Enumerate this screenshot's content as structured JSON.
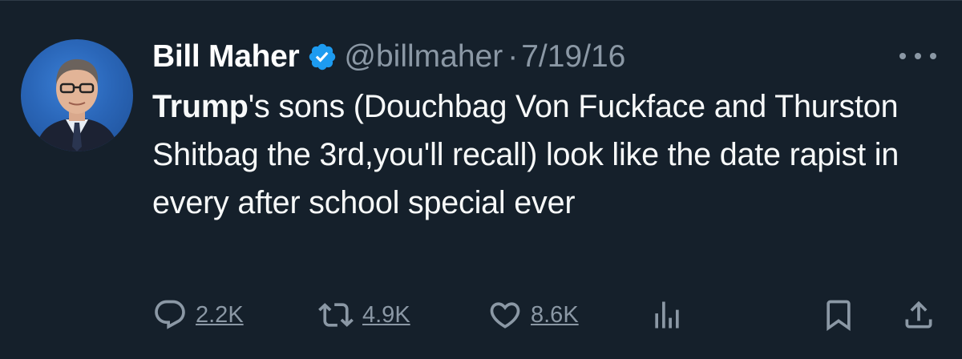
{
  "tweet": {
    "author": {
      "name": "Bill Maher",
      "handle": "@billmaher",
      "verified": true
    },
    "separator": "·",
    "date": "7/19/16",
    "text_bold": "Trump",
    "text_rest": "'s sons (Douchbag Von Fuckface and Thurston Shitbag the 3rd,you'll recall) look like the date rapist in every after school special ever",
    "stats": {
      "replies": "2.2K",
      "retweets": "4.9K",
      "likes": "8.6K"
    }
  },
  "icons": {
    "verified": "verified-badge-icon",
    "more": "more-options-icon",
    "reply": "reply-icon",
    "retweet": "retweet-icon",
    "like": "heart-icon",
    "views": "analytics-icon",
    "bookmark": "bookmark-icon",
    "share": "share-icon"
  },
  "colors": {
    "background": "#15202b",
    "text": "#f7f9f9",
    "muted": "#8b98a5",
    "verified": "#1d9bf0"
  }
}
